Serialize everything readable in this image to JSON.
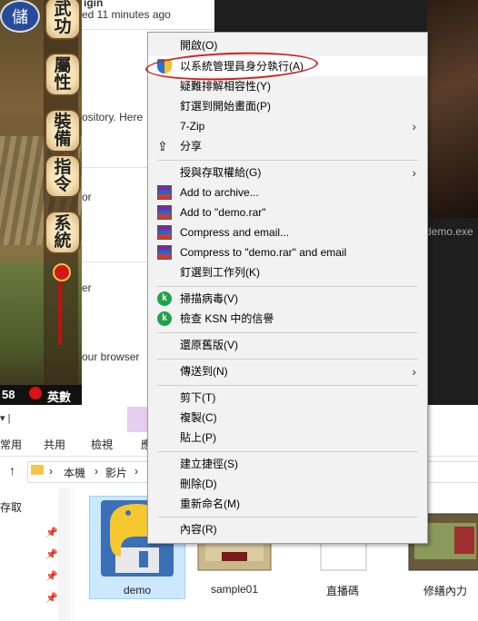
{
  "game": {
    "top_glyph": "儲",
    "lanterns": [
      "武功",
      "屬性",
      "裝備",
      "指令",
      "系統"
    ],
    "level": "58",
    "player_name": "英數"
  },
  "browser": {
    "header_partial": "igin",
    "updated": "ed 11 minutes ago",
    "snippet_repo": "ository. Here",
    "snippet_or": "or",
    "snippet_er": "er",
    "snippet_browser": "our browser",
    "exe_label": "demo.exe"
  },
  "explorer": {
    "ribbon_tabs": [
      "常用",
      "共用",
      "檢視",
      "應"
    ],
    "breadcrumb": [
      "本機",
      "影片"
    ],
    "nav_items": [
      "存取",
      "",
      "",
      ""
    ],
    "files": [
      {
        "name": "demo",
        "kind": "python",
        "selected": true
      },
      {
        "name": "sample01",
        "kind": "image",
        "selected": false
      },
      {
        "name": "直播碼",
        "kind": "doc",
        "selected": false
      },
      {
        "name": "修繕內力",
        "kind": "game",
        "selected": false
      }
    ]
  },
  "context_menu": {
    "items": {
      "open": "開啟(O)",
      "run_as_admin": "以系統管理員身分執行(A)",
      "troubleshoot": "疑難排解相容性(Y)",
      "pin_start": "釘選到開始畫面(P)",
      "seven_zip": "7-Zip",
      "share": "分享",
      "give_access": "授與存取權給(G)",
      "add_archive": "Add to archive...",
      "add_demo_rar": "Add to \"demo.rar\"",
      "compress_email": "Compress and email...",
      "compress_demo_email": "Compress to \"demo.rar\" and email",
      "pin_taskbar": "釘選到工作列(K)",
      "scan_virus": "掃描病毒(V)",
      "check_ksn": "檢查 KSN 中的信譽",
      "restore": "還原舊版(V)",
      "send_to": "傳送到(N)",
      "cut": "剪下(T)",
      "copy": "複製(C)",
      "paste": "貼上(P)",
      "create_shortcut": "建立捷徑(S)",
      "delete": "刪除(D)",
      "rename": "重新命名(M)",
      "properties": "內容(R)"
    },
    "submenu_arrow": "›",
    "kaspersky_letter": "k",
    "annotation_color": "#d21f1f"
  }
}
